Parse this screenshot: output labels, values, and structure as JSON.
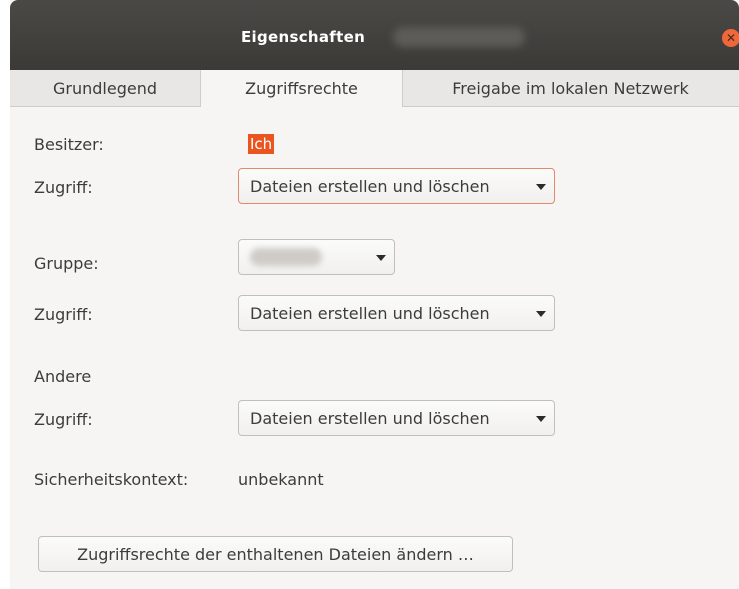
{
  "window": {
    "title": "Eigenschaften",
    "close_glyph": "✕"
  },
  "tabs": [
    {
      "label": "Grundlegend",
      "active": false
    },
    {
      "label": "Zugriffsrechte",
      "active": true
    },
    {
      "label": "Freigabe im lokalen Netzwerk",
      "active": false
    }
  ],
  "permissions": {
    "owner_label": "Besitzer:",
    "owner_value": "Ich",
    "owner_access_label": "Zugriff:",
    "owner_access_value": "Dateien erstellen und löschen",
    "group_label": "Gruppe:",
    "group_access_label": "Zugriff:",
    "group_access_value": "Dateien erstellen und löschen",
    "others_label": "Andere",
    "others_access_label": "Zugriff:",
    "others_access_value": "Dateien erstellen und löschen",
    "security_context_label": "Sicherheitskontext:",
    "security_context_value": "unbekannt"
  },
  "actions": {
    "change_contained_label": "Zugriffsrechte der enthaltenen Dateien ändern …"
  },
  "colors": {
    "accent": "#e95420",
    "close_button": "#f0673a",
    "titlebar": "#3e3d3a",
    "window_bg": "#f6f5f4"
  },
  "icons": {
    "close": "close-icon",
    "dropdown": "chevron-down-icon"
  }
}
